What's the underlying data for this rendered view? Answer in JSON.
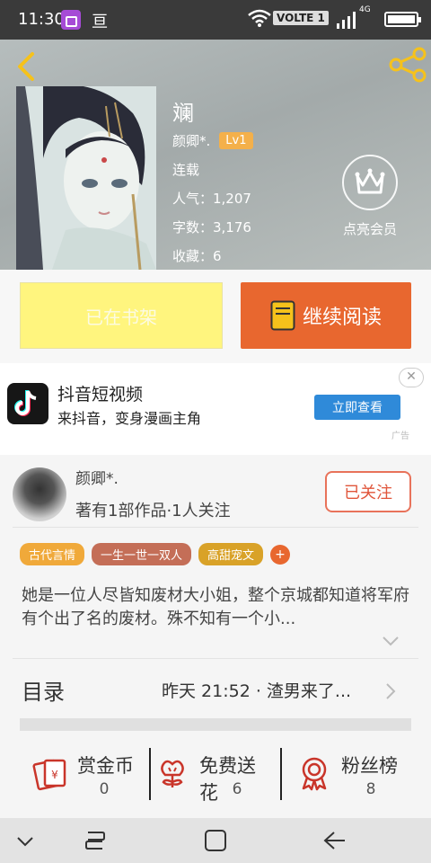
{
  "status_bar": {
    "time": "11:30",
    "app_glyph": "亘",
    "volte": "VOLTE 1",
    "network": "4G"
  },
  "book": {
    "title": "斓",
    "author": "颜卿*.",
    "level": "Lv1",
    "status": "连载",
    "popularity": "人气：1,207",
    "word_count": "字数：3,176",
    "favorites": "收藏：6"
  },
  "vip": {
    "label": "点亮会员"
  },
  "actions": {
    "in_shelf": "已在书架",
    "continue_reading": "继续阅读"
  },
  "ad": {
    "title": "抖音短视频",
    "description": "来抖音，变身漫画主角",
    "cta": "立即查看",
    "close": "✕",
    "tag": "广告"
  },
  "author_card": {
    "name": "颜卿*.",
    "stats": "著有1部作品·1人关注",
    "follow_label": "已关注"
  },
  "tags": [
    {
      "label": "古代言情",
      "color": "#f0a93a"
    },
    {
      "label": "一生一世一双人",
      "color": "#c46e57"
    },
    {
      "label": "高甜宠文",
      "color": "#d9a228"
    }
  ],
  "tag_more": "+",
  "description": "她是一位人尽皆知废材大小姐，整个京城都知道将军府有个出了名的废材。殊不知有一个小...",
  "toc": {
    "label": "目录",
    "latest": "昨天 21:52 · 渣男来了..."
  },
  "bottom_actions": [
    {
      "label": "赏金币",
      "count": "0",
      "icon": "red-envelope-icon"
    },
    {
      "label": "免费送花",
      "count": "6",
      "icon": "flower-icon"
    },
    {
      "label": "粉丝榜",
      "count": "8",
      "icon": "medal-icon"
    }
  ],
  "colors": {
    "accent": "#e8672f",
    "shelf_button": "#fff57e",
    "icon_red": "#c9352a"
  }
}
